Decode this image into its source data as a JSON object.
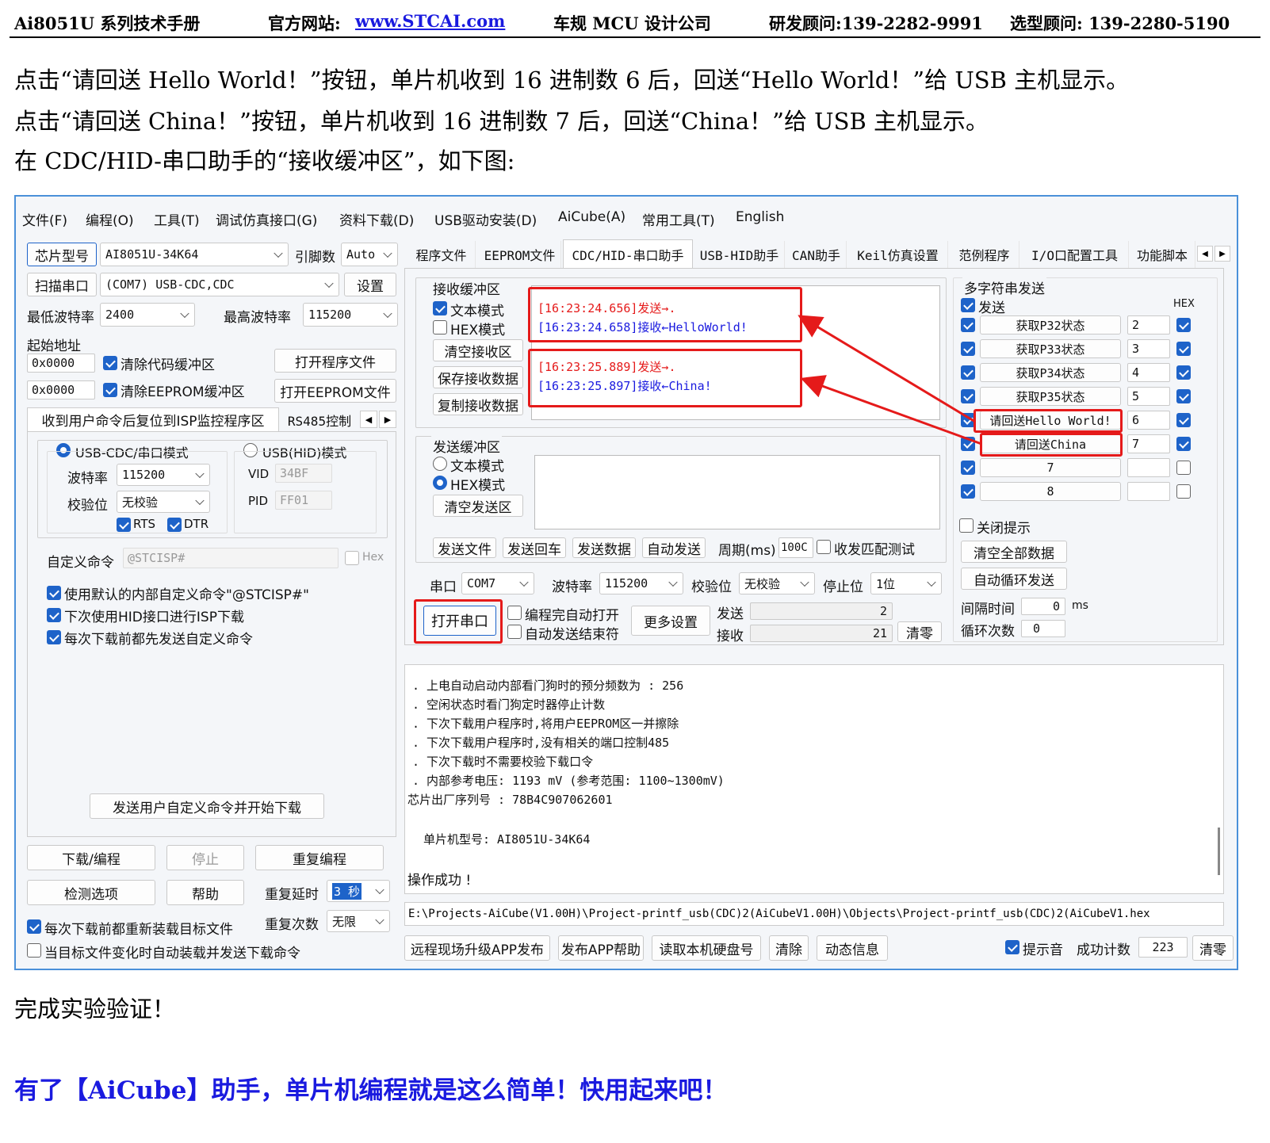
{
  "header": {
    "manual": "Ai8051U 系列技术手册",
    "site_label": "官方网站:",
    "site_link": "www.STCAI.com",
    "company": "车规 MCU 设计公司",
    "rd_consultant": "研发顾问:139-2282-9991",
    "sel_consultant": "选型顾问: 139-2280-5190"
  },
  "intro": {
    "line1": "点击“请回送 Hello World！”按钮，单片机收到 16 进制数 6 后，回送“Hello World！”给 USB 主机显示。",
    "line2": "点击“请回送 China！”按钮，单片机收到 16 进制数 7 后，回送“China！”给 USB 主机显示。",
    "line3": "在 CDC/HID-串口助手的“接收缓冲区”，如下图:"
  },
  "app": {
    "menu": [
      "文件(F)",
      "编程(O)",
      "工具(T)",
      "调试仿真接口(G)",
      "资料下载(D)",
      "USB驱动安装(D)",
      "AiCube(A)",
      "常用工具(T)",
      "English"
    ],
    "left": {
      "chip_btn": "芯片型号",
      "chip_value": "AI8051U-34K64",
      "pins_label": "引脚数",
      "pins_value": "Auto",
      "scan_btn": "扫描串口",
      "port_value": "(COM7) USB-CDC,CDC",
      "settings_btn": "设置",
      "min_baud_label": "最低波特率",
      "min_baud_value": "2400",
      "max_baud_label": "最高波特率",
      "max_baud_value": "115200",
      "start_addr_label": "起始地址",
      "addr1": "0x0000",
      "clear_code": "清除代码缓冲区",
      "open_prog_btn": "打开程序文件",
      "addr2": "0x0000",
      "clear_eeprom": "清除EEPROM缓冲区",
      "open_eeprom_btn": "打开EEPROM文件",
      "subtab_isp": "收到用户命令后复位到ISP监控程序区",
      "subtab_rs485": "RS485控制",
      "usb_cdc_mode": "USB-CDC/串口模式",
      "usb_hid_mode": "USB(HID)模式",
      "baud_label": "波特率",
      "baud_value": "115200",
      "parity_label": "校验位",
      "parity_value": "无校验",
      "rts": "RTS",
      "dtr": "DTR",
      "vid_label": "VID",
      "vid_value": "34BF",
      "pid_label": "PID",
      "pid_value": "FF01",
      "custom_cmd_label": "自定义命令",
      "custom_cmd_value": "@STCISP#",
      "hex_label": "Hex",
      "opt1": "使用默认的内部自定义命令\"@STCISP#\"",
      "opt2": "下次使用HID接口进行ISP下载",
      "opt3": "每次下载前都先发送自定义命令",
      "send_custom_btn": "发送用户自定义命令并开始下载",
      "download_btn": "下载/编程",
      "stop_btn": "停止",
      "reprog_btn": "重复编程",
      "check_btn": "检测选项",
      "help_btn": "帮助",
      "delay_label": "重复延时",
      "delay_value": "3 秒",
      "count_label": "重复次数",
      "count_value": "无限",
      "reload_opt": "每次下载前都重新装载目标文件",
      "auto_opt": "当目标文件变化时自动装载并发送下载命令"
    },
    "tabs": [
      "程序文件",
      "EEPROM文件",
      "CDC/HID-串口助手",
      "USB-HID助手",
      "CAN助手",
      "Keil仿真设置",
      "范例程序",
      "I/O口配置工具",
      "功能脚本"
    ],
    "recv": {
      "title": "接收缓冲区",
      "text_mode": "文本模式",
      "hex_mode": "HEX模式",
      "clear_btn": "清空接收区",
      "save_btn": "保存接收数据",
      "copy_btn": "复制接收数据",
      "log1a": "[16:23:24.656]发送→.",
      "log1b": "[16:23:24.658]接收←HelloWorld!",
      "log2a": "[16:23:25.889]发送→.",
      "log2b": "[16:23:25.897]接收←China!"
    },
    "send": {
      "title": "发送缓冲区",
      "text_mode": "文本模式",
      "hex_mode": "HEX模式",
      "clear_btn": "清空发送区",
      "send_file": "发送文件",
      "send_cr": "发送回车",
      "send_data": "发送数据",
      "auto_send": "自动发送",
      "period_label": "周期(ms)",
      "period_value": "100C",
      "match_test": "收发匹配测试"
    },
    "serial": {
      "port_label": "串口",
      "port_value": "COM7",
      "baud_label": "波特率",
      "baud_value": "115200",
      "parity_label": "校验位",
      "parity_value": "无校验",
      "stop_label": "停止位",
      "stop_value": "1位",
      "open_btn": "打开串口",
      "auto_open": "编程完自动打开",
      "auto_end": "自动发送结束符",
      "more_btn": "更多设置",
      "send_label": "发送",
      "send_count": "2",
      "recv_label": "接收",
      "recv_count": "21",
      "clear_btn": "清零"
    },
    "multi": {
      "title": "多字符串发送",
      "send_label": "发送",
      "hex_label": "HEX",
      "rows": [
        {
          "label": "获取P32状态",
          "value": "2"
        },
        {
          "label": "获取P33状态",
          "value": "3"
        },
        {
          "label": "获取P34状态",
          "value": "4"
        },
        {
          "label": "获取P35状态",
          "value": "5"
        },
        {
          "label": "请回送Hello World!",
          "value": "6"
        },
        {
          "label": "请回送China",
          "value": "7"
        },
        {
          "label": "7",
          "value": ""
        },
        {
          "label": "8",
          "value": ""
        }
      ],
      "close_hint": "关闭提示",
      "clear_all_btn": "清空全部数据",
      "auto_loop_btn": "自动循环发送",
      "interval_label": "间隔时间",
      "interval_value": "0",
      "interval_unit": "ms",
      "loop_label": "循环次数",
      "loop_value": "0"
    },
    "log": [
      ". 上电自动启动内部看门狗时的预分频数为 : 256",
      ". 空闲状态时看门狗定时器停止计数",
      ". 下次下载用户程序时,将用户EEPROM区一并擦除",
      ". 下次下载用户程序时,没有相关的端口控制485",
      ". 下次下载时不需要校验下载口令",
      ". 内部参考电压: 1193 mV (参考范围: 1100~1300mV)",
      "芯片出厂序列号 : 78B4C907062601",
      "单片机型号: AI8051U-34K64",
      "操作成功 !"
    ],
    "path": "E:\\Projects-AiCube(V1.00H)\\Project-printf_usb(CDC)2(AiCubeV1.00H)\\Objects\\Project-printf_usb(CDC)2(AiCubeV1.hex",
    "bottom": {
      "remote_btn": "远程现场升级APP发布",
      "publish_btn": "发布APP帮助",
      "disk_btn": "读取本机硬盘号",
      "clear_btn": "清除",
      "dynamic_btn": "动态信息",
      "sound_label": "提示音",
      "success_label": "成功计数",
      "success_value": "223",
      "reset_btn": "清零"
    }
  },
  "footer": {
    "done": "完成实验验证！",
    "slogan": "有了【AiCube】助手，单片机编程就是这么简单！快用起来吧！"
  },
  "colors": {
    "accent": "#1e63c9",
    "highlight": "#e51a1a",
    "slogan": "#1a1adf"
  }
}
